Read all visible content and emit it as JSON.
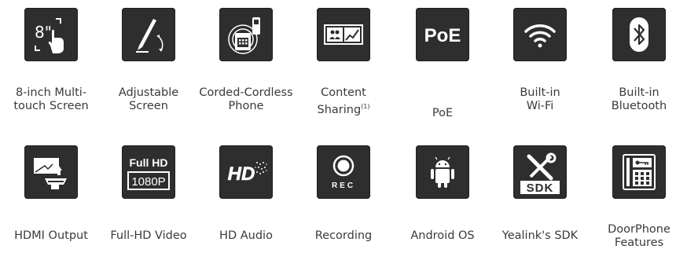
{
  "row1": [
    {
      "label": "8-inch Multi-\ntouch Screen",
      "icon": "touch-screen-icon",
      "tile_text": "8\""
    },
    {
      "label": "Adjustable\nScreen",
      "icon": "adjustable-screen-icon"
    },
    {
      "label": "Corded-Cordless\nPhone",
      "icon": "corded-cordless-phone-icon"
    },
    {
      "label": "Content\nSharing",
      "label_sup": "(1)",
      "icon": "content-sharing-icon"
    },
    {
      "label": "PoE",
      "icon": "poe-icon",
      "tile_text": "PoE"
    },
    {
      "label": "Built-in\nWi-Fi",
      "icon": "wifi-icon"
    },
    {
      "label": "Built-in\nBluetooth",
      "icon": "bluetooth-icon"
    }
  ],
  "row2": [
    {
      "label": "HDMI Output",
      "icon": "hdmi-output-icon"
    },
    {
      "label": "Full-HD Video",
      "icon": "full-hd-video-icon",
      "tile_text_top": "Full HD",
      "tile_text_bottom": "1080P"
    },
    {
      "label": "HD Audio",
      "icon": "hd-audio-icon",
      "tile_text": "HD"
    },
    {
      "label": "Recording",
      "icon": "recording-icon",
      "tile_text": "REC"
    },
    {
      "label": "Android OS",
      "icon": "android-icon"
    },
    {
      "label": "Yealink's SDK",
      "icon": "sdk-icon",
      "tile_text": "SDK"
    },
    {
      "label": "DoorPhone\nFeatures",
      "icon": "doorphone-icon"
    }
  ],
  "colors": {
    "tile": "#2e2e2e",
    "icon": "#ffffff",
    "text": "#3a3a3a"
  }
}
